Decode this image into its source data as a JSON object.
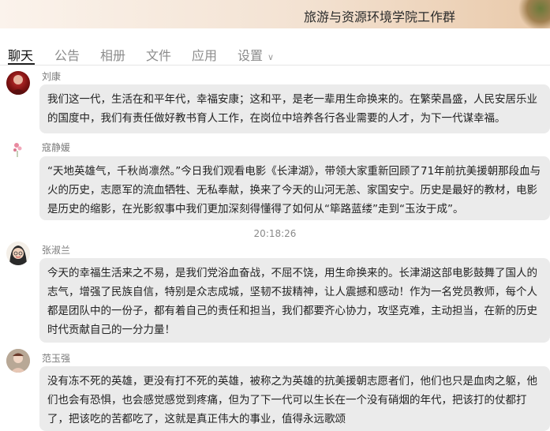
{
  "window": {
    "title": "旅游与资源环境学院工作群"
  },
  "tabs": [
    {
      "label": "聊天"
    },
    {
      "label": "公告"
    },
    {
      "label": "相册"
    },
    {
      "label": "文件"
    },
    {
      "label": "应用"
    },
    {
      "label": "设置"
    }
  ],
  "messages": [
    {
      "sender": "刘康",
      "text": "我们这一代，生活在和平年代，幸福安康；这和平，是老一辈用生命换来的。在繁荣昌盛，人民安居乐业的国度中，我们有责任做好教书育人工作，在岗位中培养各行各业需要的人才，为下一代谋幸福。"
    },
    {
      "sender": "寇静媛",
      "text": "“天地英雄气，千秋尚凛然。”今日我们观看电影《长津湖》，带领大家重新回顾了71年前抗美援朝那段血与火的历史，志愿军的流血牺牲、无私奉献，换来了今天的山河无恙、家国安宁。历史是最好的教材，电影是历史的缩影，在光影叙事中我们更加深刻得懂得了如何从“筚路蓝缕”走到“玉汝于成”。"
    },
    {
      "sender": "张淑兰",
      "text": "今天的幸福生活来之不易，是我们党浴血奋战，不屈不饶，用生命换来的。长津湖这部电影鼓舞了国人的志气，增强了民族自信，特别是众志成城，坚韧不拔精神，让人震撼和感动！作为一名党员教师，每个人都是团队中的一份子，都有着自己的责任和担当，我们都要齐心协力，攻坚克难，主动担当，在新的历史时代贡献自己的一分力量！"
    },
    {
      "sender": "范玉强",
      "text": "没有冻不死的英雄，更没有打不死的英雄，被称之为英雄的抗美援朝志愿者们，他们也只是血肉之躯，他们也会有恐惧，也会感觉感觉到疼痛，但为了下一代可以生长在一个没有硝烟的年代，把该打的仗都打了，把该吃的苦都吃了，这就是真正伟大的事业，值得永远歌颂"
    }
  ],
  "timestamp": "20:18:26"
}
